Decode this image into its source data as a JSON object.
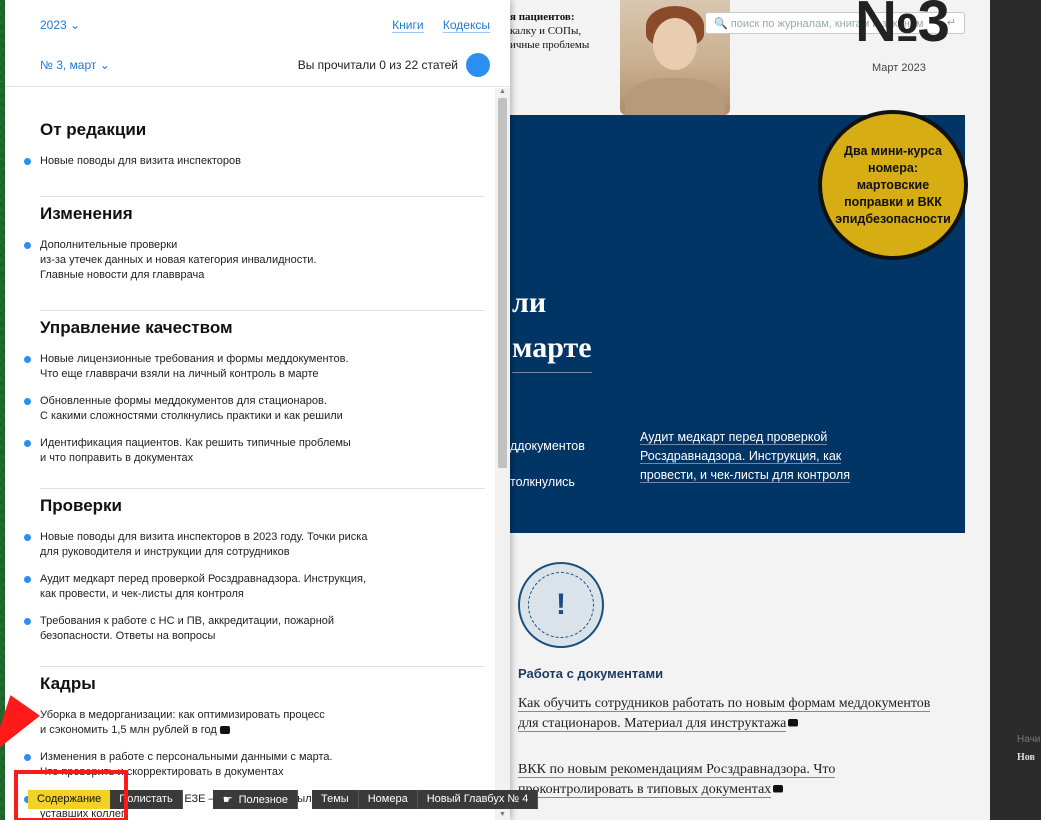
{
  "toc": {
    "year": "2023",
    "links": [
      "Книги",
      "Кодексы"
    ],
    "issue": "№ 3, март",
    "progress": "Вы прочитали 0 из 22 статей",
    "sections": [
      {
        "title": "От редакции",
        "items": [
          {
            "text": "Новые поводы для визита инспекторов",
            "video": false
          }
        ]
      },
      {
        "title": "Изменения",
        "items": [
          {
            "text": "Дополнительные проверки\nиз-за утечек данных и новая категория инвалидности.\nГлавные новости для главврача",
            "video": false
          }
        ]
      },
      {
        "title": "Управление качеством",
        "items": [
          {
            "text": "Новые лицензионные требования и формы меддокументов.\nЧто еще главврачи взяли на личный контроль в марте",
            "video": false
          },
          {
            "text": "Обновленные формы меддокументов для стационаров.\nС какими сложностями столкнулись практики и как решили",
            "video": false
          },
          {
            "text": "Идентификация пациентов. Как решить типичные проблемы\nи что поправить в документах",
            "video": false
          }
        ]
      },
      {
        "title": "Проверки",
        "items": [
          {
            "text": "Новые поводы для визита инспекторов в 2023 году. Точки риска\nдля руководителя и инструкции для сотрудников",
            "video": false
          },
          {
            "text": "Аудит медкарт перед проверкой Росздравнадзора. Инструкция,\nкак провести, и чек-листы для контроля",
            "video": false
          },
          {
            "text": "Требования к работе с НС и ПВ, аккредитации, пожарной\nбезопасности. Ответы на вопросы",
            "video": false
          }
        ]
      },
      {
        "title": "Кадры",
        "items": [
          {
            "text": "Уборка в медорганизации: как оптимизировать процесс\nи сэкономить 1,5 млн рублей в год",
            "video": true
          },
          {
            "text": "Изменения в работе с персональными данными с марта.\nЧто проверить и скорректировать в документах",
            "video": false
          },
          {
            "text": "Повышение квалификации, ЕЗЕ — соф-т, чтобы было проще\nуставших коллег",
            "video": false
          }
        ]
      }
    ]
  },
  "magazine": {
    "top_text_bold": "я пациентов:",
    "top_text_lines": [
      "калку и СОПы,",
      "ичные проблемы"
    ],
    "search_placeholder": "поиск по журналам, книгам и законам",
    "issue_number": "№3",
    "issue_date": "Март 2023",
    "badge": "Два мини-курса номера: мартовские поправки и ВКК эпидбезопасности",
    "headline_1": "ли",
    "headline_2": "марте",
    "blue_left_1": "ддокументов",
    "blue_left_2": "толкнулись",
    "blue_right": "Аудит медкарт перед проверкой Росздравнадзора. Инструкция, как провести, и чек-листы для контроля",
    "section_heading": "Работа с документами",
    "link_1": "Как обучить сотрудников работать по новым формам меддокументов для стационаров. Материал для инструктажа",
    "link_2": "ВКК по новым рекомендациям Росздравнадзора. Что проконтролировать в типовых документах"
  },
  "side": {
    "small1": "Начи",
    "small2": "Нов"
  },
  "toolbar": {
    "contents": "Содержание",
    "browse": "Полистать",
    "useful": "Полезное",
    "themes": "Темы",
    "issues": "Номера",
    "new_issue": "Новый Главбух № 4"
  },
  "colors": {
    "accent": "#2b8ff0",
    "highlight": "#f2d224",
    "navy": "#003566",
    "annotation": "#ff1a1a"
  }
}
